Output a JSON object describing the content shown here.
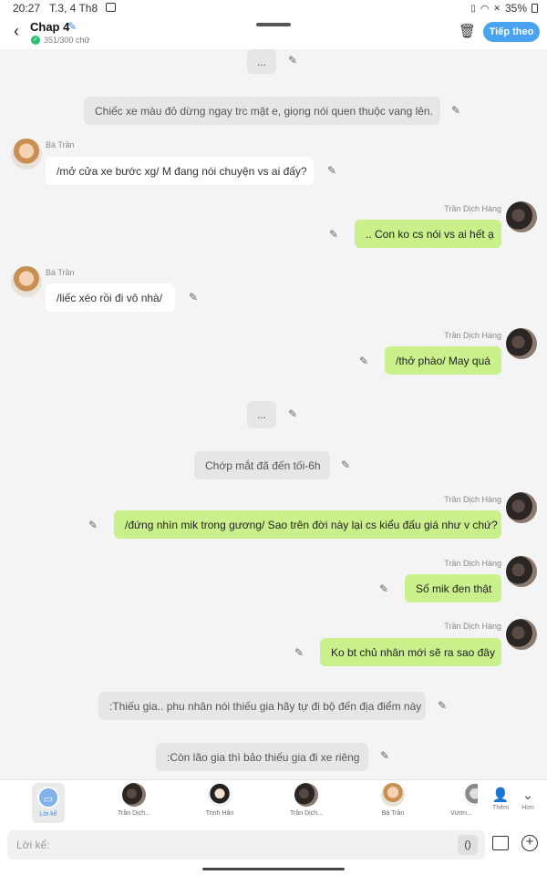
{
  "status_bar": {
    "time": "20:27",
    "date": "T.3, 4 Th8",
    "battery": "35%"
  },
  "header": {
    "title": "Chap 4",
    "word_count": "351/300 chữ",
    "next_label": "Tiếp theo"
  },
  "messages": [
    {
      "type": "narration",
      "text": "..."
    },
    {
      "type": "narration",
      "text": "Chiếc xe màu đỏ dừng ngay trc mặt e, giọng nói quen thuộc vang lên."
    },
    {
      "type": "left",
      "speaker": "Bà Trần",
      "text": "/mở cửa xe bước xg/ M đang nói chuyện vs ai đấy?"
    },
    {
      "type": "right",
      "speaker": "Trần Dịch Hàng",
      "text": ".. Con ko cs nói vs ai hết ạ"
    },
    {
      "type": "left",
      "speaker": "Bà Trần",
      "text": "/liếc xéo rồi đi vô nhà/"
    },
    {
      "type": "right",
      "speaker": "Trần Dịch Hàng",
      "text": "/thở phào/ May quá"
    },
    {
      "type": "narration",
      "text": "..."
    },
    {
      "type": "narration",
      "text": "Chớp mắt đã đến tối-6h"
    },
    {
      "type": "right",
      "speaker": "Trần Dịch Hàng",
      "text": "/đứng nhìn mik trong gương/ Sao trên đời này lại cs kiểu đấu giá như v chứ?"
    },
    {
      "type": "right",
      "speaker": "Trần Dịch Hàng",
      "text": "Số mik đen thật"
    },
    {
      "type": "right",
      "speaker": "Trần Dịch Hàng",
      "text": "Ko bt chủ nhân mới sẽ ra sao đây"
    },
    {
      "type": "narration",
      "text": ":Thiếu gia.. phu nhân nói thiếu gia hãy tự đi bộ đến địa điểm này"
    },
    {
      "type": "narration",
      "text": ":Còn lão gia thì bảo thiếu gia đi xe riêng"
    }
  ],
  "characters": [
    {
      "label": "Lời kể"
    },
    {
      "label": "Trần Dịch..."
    },
    {
      "label": "Trịnh Hân"
    },
    {
      "label": "Trần Dịch..."
    },
    {
      "label": "Bà Trần"
    },
    {
      "label": "Vươn..."
    }
  ],
  "actions": {
    "add_label": "Thêm",
    "less_label": "Hơn"
  },
  "input": {
    "placeholder": "Lời kể:",
    "paren": "()"
  }
}
